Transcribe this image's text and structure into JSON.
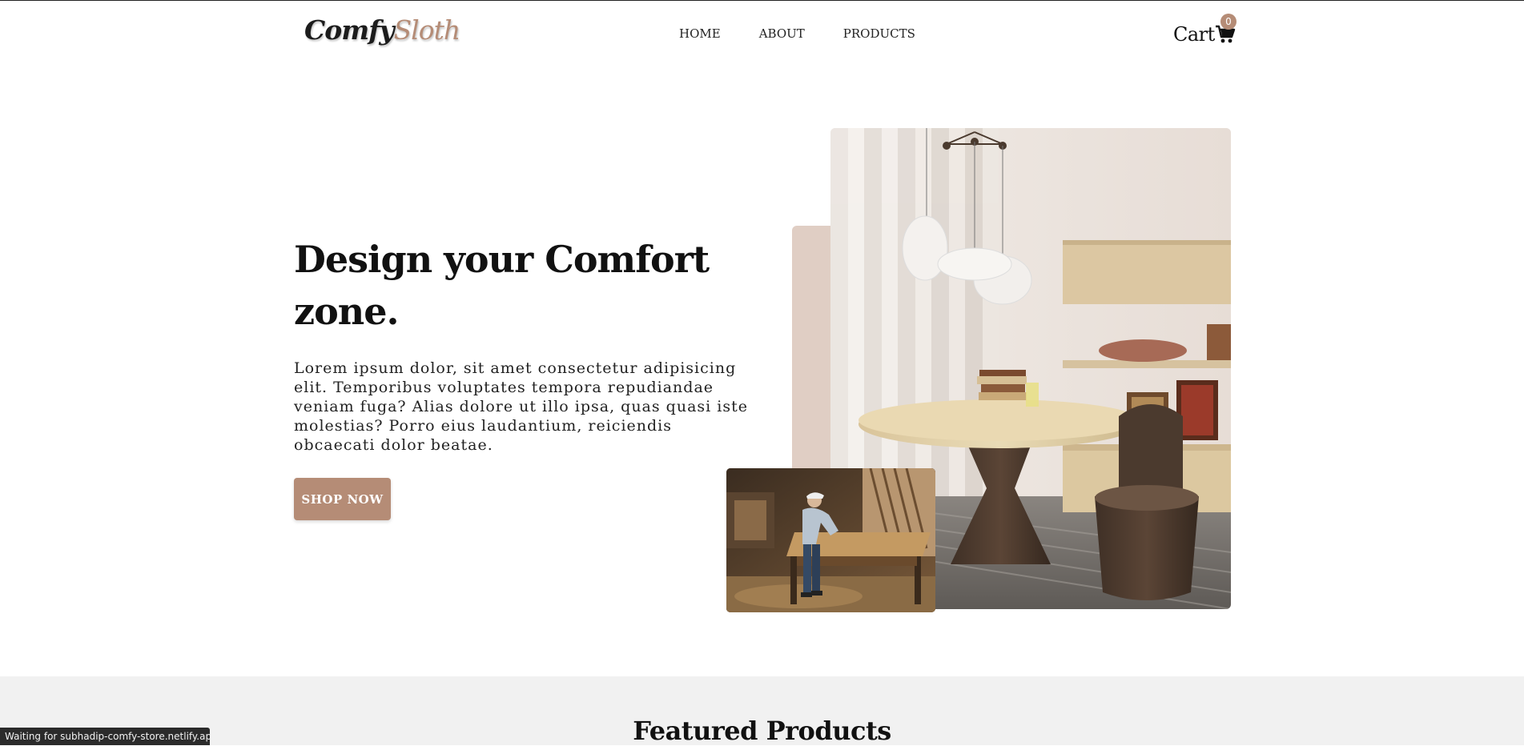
{
  "header": {
    "logo_part_a": "Comfy",
    "logo_part_b": "Sloth",
    "nav": [
      {
        "label": "HOME"
      },
      {
        "label": "ABOUT"
      },
      {
        "label": "PRODUCTS"
      }
    ],
    "cart_label": "Cart",
    "cart_count": "0"
  },
  "hero": {
    "title": "Design your Comfort zone.",
    "description": "Lorem ipsum dolor, sit amet consectetur adipisicing elit. Temporibus voluptates tempora repudiandae veniam fuga? Alias dolore ut illo ipsa, quas quasi iste molestias? Porro eius laudantium, reiciendis obcaecati dolor beatae.",
    "cta_label": "SHOP NOW"
  },
  "featured": {
    "title": "Featured Products"
  },
  "status_bar": {
    "text": "Waiting for subhadip-comfy-store.netlify.app..."
  },
  "colors": {
    "accent": "#b58c76",
    "accent_light": "#e0cec4",
    "section_bg": "#f1f1f1"
  },
  "icons": {
    "cart": "cart-icon"
  }
}
